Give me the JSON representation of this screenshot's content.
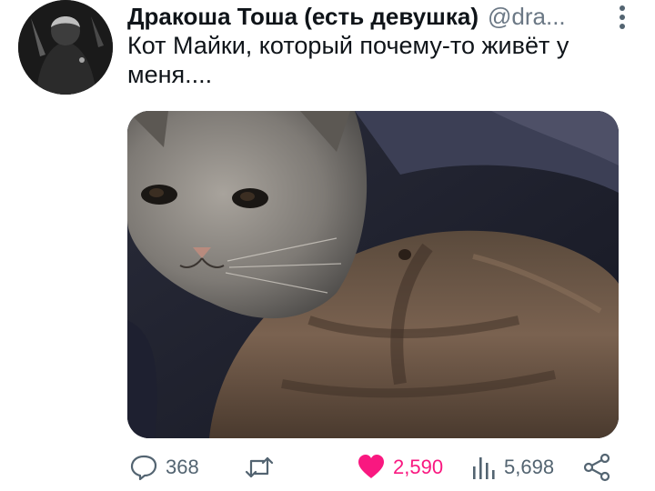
{
  "tweet": {
    "display_name": "Дракоша Тоша (есть девушка)",
    "handle": "@dra...",
    "text": "Кот Майки, который почему-то живёт у меня...."
  },
  "actions": {
    "replies": "368",
    "likes": "2,590",
    "views": "5,698"
  },
  "icons": {
    "reply": "speech-bubble-icon",
    "retweet": "retweet-icon",
    "like": "heart-icon",
    "views": "bar-chart-icon",
    "share": "share-icon",
    "more": "vertical-dots-icon"
  },
  "colors": {
    "like": "#f91880",
    "secondary_text": "#536471",
    "primary_text": "#0f1419"
  }
}
